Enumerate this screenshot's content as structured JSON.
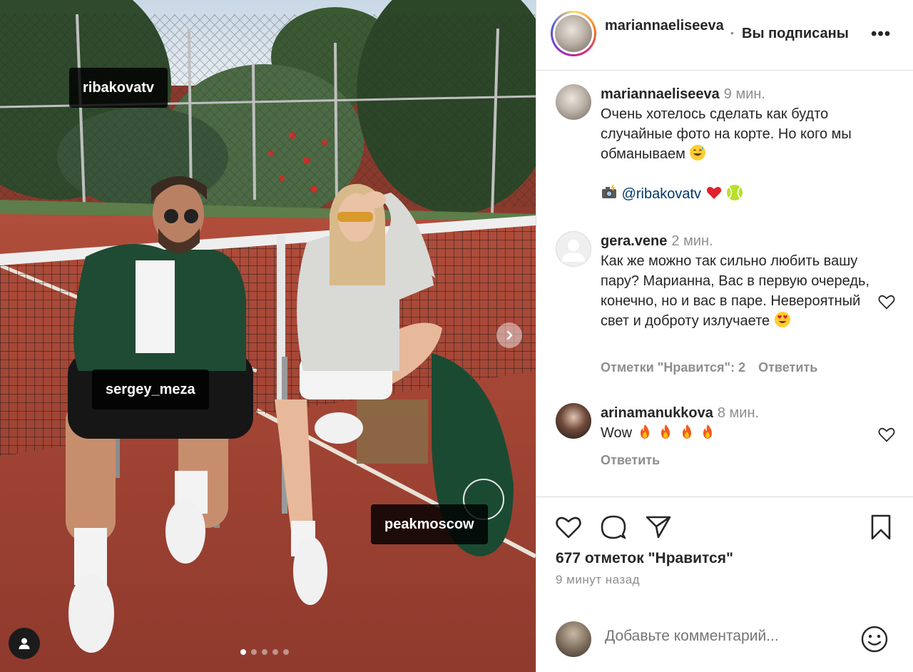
{
  "post": {
    "photo": {
      "tags": [
        "ribakovatv",
        "sergey_meza",
        "peakmoscow"
      ],
      "carousel_count": 5,
      "carousel_active": 1
    },
    "header": {
      "username": "mariannaeliseeva",
      "separator": "•",
      "follow_status": "Вы подписаны",
      "more": "•••"
    },
    "caption": {
      "username": "mariannaeliseeva",
      "time": "9 мин.",
      "text": "Очень хотелось сделать как будто случайные фото на корте. Но кого мы обманываем",
      "credit_mention": "@ribakovatv"
    },
    "comments": [
      {
        "username": "gera.vene",
        "time": "2 мин.",
        "text": "Как же можно так сильно любить вашу пару? Марианна, Вас в первую очередь, конечно, но и вас в паре. Невероятный свет и доброту излучаете",
        "likes_label": "Отметки \"Нравится\": 2",
        "reply_label": "Ответить"
      },
      {
        "username": "arinamanukkova",
        "time": "8 мин.",
        "text": "Wow",
        "reply_label": "Ответить"
      }
    ],
    "likes_text": "677 отметок \"Нравится\"",
    "posted_ago": "9 минут назад",
    "add_comment_placeholder": "Добавьте комментарий..."
  },
  "colors": {
    "text": "#262626",
    "secondary": "#8e8e8e",
    "mention": "#00376b",
    "border": "#dbdbdb",
    "court": "#a7473a"
  },
  "icons": [
    "heart-icon",
    "comment-icon",
    "share-icon",
    "bookmark-icon",
    "emoji-icon",
    "chevron-right-icon",
    "user-tag-icon"
  ]
}
